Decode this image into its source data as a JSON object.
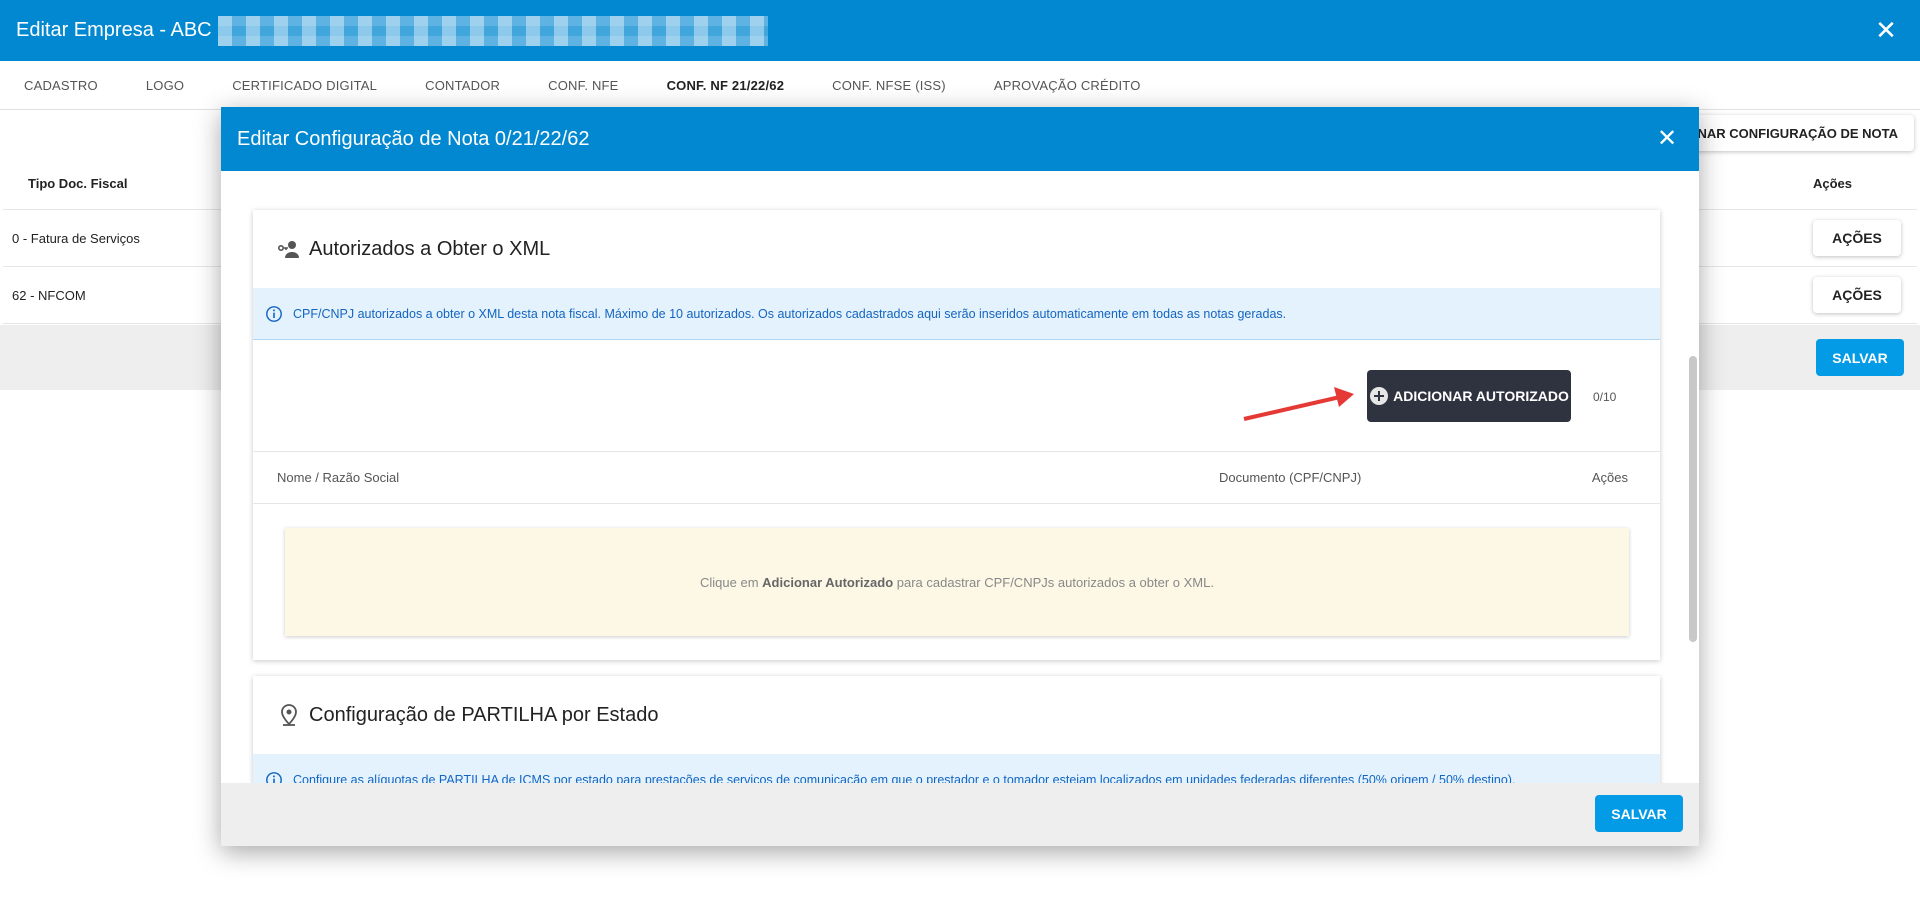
{
  "app": {
    "title": "Editar Empresa - ABC",
    "close_icon": "close-icon"
  },
  "tabs": [
    {
      "label": "CADASTRO"
    },
    {
      "label": "LOGO"
    },
    {
      "label": "CERTIFICADO DIGITAL"
    },
    {
      "label": "CONTADOR"
    },
    {
      "label": "CONF. NFE"
    },
    {
      "label": "CONF. NF 21/22/62"
    },
    {
      "label": "CONF. NFSE (ISS)"
    },
    {
      "label": "APROVAÇÃO CRÉDITO"
    }
  ],
  "active_tab": "CONF. NF 21/22/62",
  "background": {
    "add_button": "ONAR CONFIGURAÇÃO DE NOTA",
    "table": {
      "col_tipo": "Tipo Doc. Fiscal",
      "col_acoes": "Ações",
      "rows": [
        {
          "tipo": "0 - Fatura de Serviços",
          "action": "AÇÕES"
        },
        {
          "tipo": "62 - NFCOM",
          "action": "AÇÕES"
        }
      ]
    },
    "save_label": "SALVAR"
  },
  "modal": {
    "title": "Editar Configuração de Nota 0/21/22/62",
    "save_label": "SALVAR",
    "section1": {
      "title": "Autorizados a Obter o XML",
      "info": "CPF/CNPJ autorizados a obter o XML desta nota fiscal. Máximo de 10 autorizados. Os autorizados cadastrados aqui serão inseridos automaticamente em todas as notas geradas.",
      "add_button": "ADICIONAR AUTORIZADO",
      "counter": "0/10",
      "columns": {
        "nome": "Nome / Razão Social",
        "documento": "Documento (CPF/CNPJ)",
        "acoes": "Ações"
      },
      "empty": {
        "prefix": "Clique em",
        "bold": "Adicionar Autorizado",
        "suffix": "para cadastrar CPF/CNPJs autorizados a obter o XML."
      }
    },
    "section2": {
      "title": "Configuração de PARTILHA por Estado",
      "info": "Configure as alíquotas de PARTILHA de ICMS por estado para prestações de serviços de comunicação em que o prestador e o tomador estejam localizados em unidades federadas diferentes (50% origem / 50% destino)."
    }
  },
  "colors": {
    "primary": "#0288d1",
    "save": "#039be5",
    "dark_button": "#2f3340",
    "info_bg": "#e3f2fd",
    "info_text": "#1565c0",
    "empty_bg": "#fdf8e6",
    "arrow": "#e53935"
  }
}
